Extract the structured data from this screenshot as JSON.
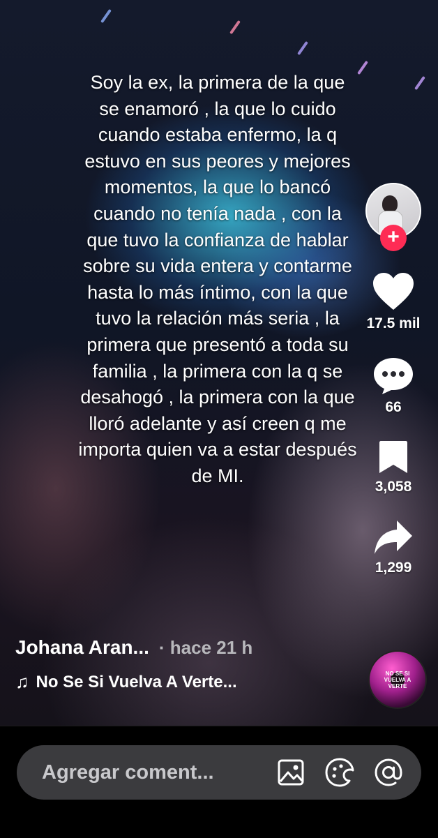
{
  "overlay": {
    "text": "Soy la ex, la primera de la que se enamoró , la que lo cuido cuando estaba enfermo, la q estuvo en sus peores y mejores momentos, la que lo bancó cuando no tenía nada , con la que tuvo la confianza de hablar sobre su vida entera y contarme hasta lo más íntimo, con la que tuvo la relación más seria , la primera que presentó a toda su familia , la primera con la q se desahogó , la primera con la que lloró adelante y así creen q me importa quien va a estar después de MI."
  },
  "rail": {
    "follow_label": "+",
    "likes": "17.5 mil",
    "comments": "66",
    "saves": "3,058",
    "shares": "1,299"
  },
  "post": {
    "author": "Johana Aran...",
    "time": "· hace 21 h",
    "music_note": "♫",
    "music": "No Se Si Vuelva A Verte...",
    "disc_text": "NO SE SI VUELVA A VERTE"
  },
  "comment": {
    "placeholder": "Agregar coment..."
  },
  "colors": {
    "accent": "#fe2c55",
    "input_bg": "#3b3b3e"
  }
}
